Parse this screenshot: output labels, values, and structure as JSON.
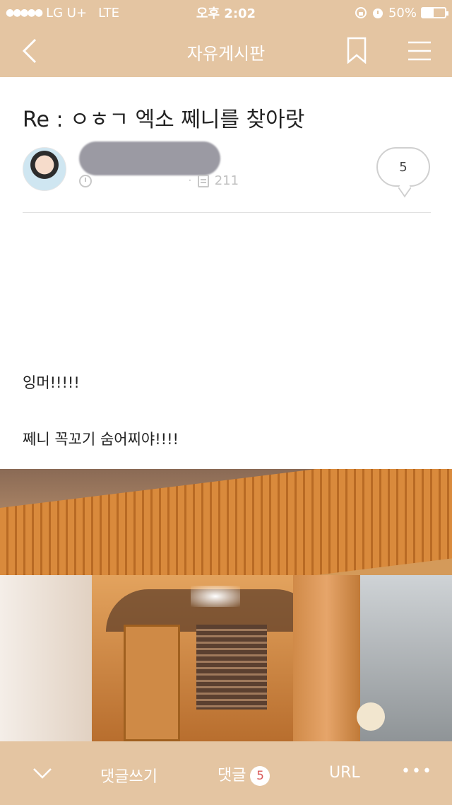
{
  "status_bar": {
    "signal": "●●●●●",
    "carrier": "LG U+",
    "network": "LTE",
    "time": "오후 2:02",
    "battery_percent": "50%",
    "battery_level": 0.5
  },
  "nav": {
    "title": "자유게시판",
    "back_icon": "chevron-left-icon",
    "bookmark_icon": "bookmark-icon",
    "menu_icon": "menu-icon"
  },
  "post": {
    "title": "Re : ㅇㅎㄱ 엑소 쩨니를 찾아랏",
    "views": "211",
    "comment_count": "5",
    "body_lines": [
      "잉머!!!!!",
      "쩨니 꼭꼬기 숨어찌야!!!!"
    ]
  },
  "bottom_bar": {
    "write_comment": "댓글쓰기",
    "comments": "댓글",
    "comments_count": "5",
    "url": "URL",
    "more": "•••"
  },
  "colors": {
    "accent": "#e4c5a2"
  }
}
